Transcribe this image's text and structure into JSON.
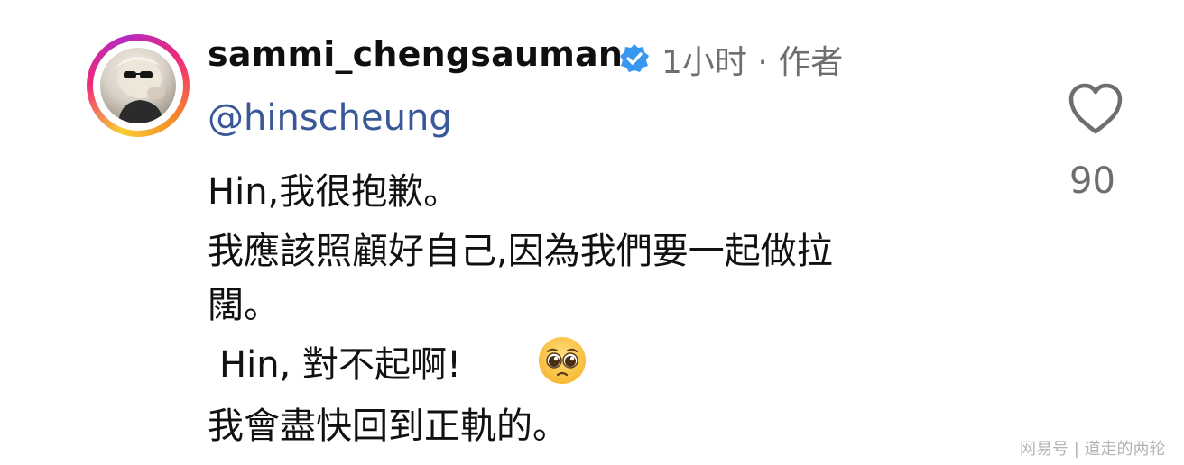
{
  "comment": {
    "username": "sammi_chengsauman",
    "meta": "1小时 · 作者",
    "mention": "@hinscheung",
    "lines": [
      "Hin,我很抱歉。",
      "我應該照顧好自己,因為我們要一起做拉",
      "闊。",
      "Hin, 對不起啊!",
      "我會盡快回到正軌的。"
    ],
    "emoji": "pleading-face",
    "verified_color": "#3897f0",
    "mention_color": "#385898"
  },
  "like": {
    "icon": "heart-icon",
    "count": "90"
  },
  "watermark": "网易号 | 道走的两轮"
}
